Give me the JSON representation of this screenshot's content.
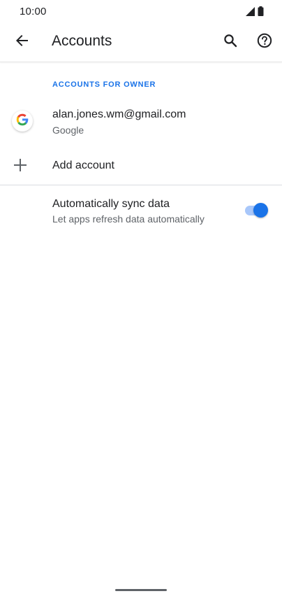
{
  "status_bar": {
    "time": "10:00",
    "icons": [
      "signal-icon",
      "battery-icon"
    ]
  },
  "app_bar": {
    "title": "Accounts",
    "back_icon": "arrow-back-icon",
    "search_icon": "search-icon",
    "help_icon": "help-circle-icon"
  },
  "accounts_section": {
    "header": "ACCOUNTS FOR OWNER",
    "accounts": [
      {
        "email": "alan.jones.wm@gmail.com",
        "type": "Google",
        "icon": "google-g-icon"
      }
    ],
    "add_account": {
      "label": "Add account",
      "icon": "plus-icon"
    }
  },
  "sync": {
    "title": "Automatically sync data",
    "subtitle": "Let apps refresh data automatically",
    "enabled": true
  },
  "colors": {
    "accent": "#1a73e8",
    "toggle_track": "#a8c7fa",
    "primary_text": "#202124",
    "secondary_text": "#5f6368"
  }
}
